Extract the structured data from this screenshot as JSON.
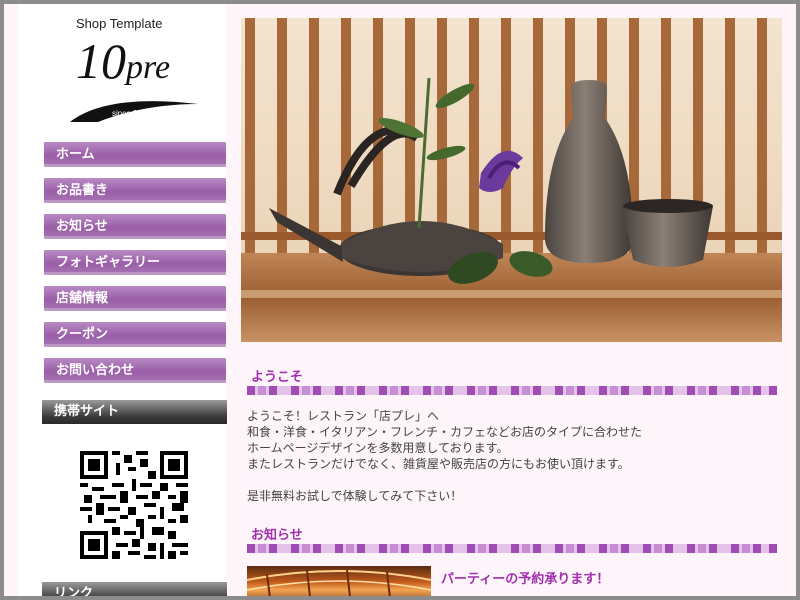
{
  "logo": {
    "small": "Shop Template",
    "big_number": "10",
    "big_suffix": "pre",
    "since": "since 2009"
  },
  "nav": {
    "items": [
      {
        "label": "ホーム"
      },
      {
        "label": "お品書き"
      },
      {
        "label": "お知らせ"
      },
      {
        "label": "フォトギャラリー"
      },
      {
        "label": "店舗情報"
      },
      {
        "label": "クーポン"
      },
      {
        "label": "お問い合わせ"
      }
    ]
  },
  "sidebar": {
    "mobile_heading": "携帯サイト",
    "links_heading": "リンク"
  },
  "welcome": {
    "heading": "ようこそ",
    "lines": [
      "ようこそ！レストラン「店プレ」へ",
      "和食・洋食・イタリアン・フレンチ・カフェなどお店のタイプに合わせた",
      "ホームページデザインを多数用意しております。",
      "またレストランだけでなく、雑貨屋や販売店の方にもお使い頂けます。",
      "",
      "是非無料お試しで体験してみて下さい！"
    ]
  },
  "news": {
    "heading": "お知らせ",
    "item_title": "パーティーの予約承ります！"
  },
  "colors": {
    "accent": "#a22fb0",
    "nav": "#9a5ea8",
    "background": "#fdf5fa"
  }
}
